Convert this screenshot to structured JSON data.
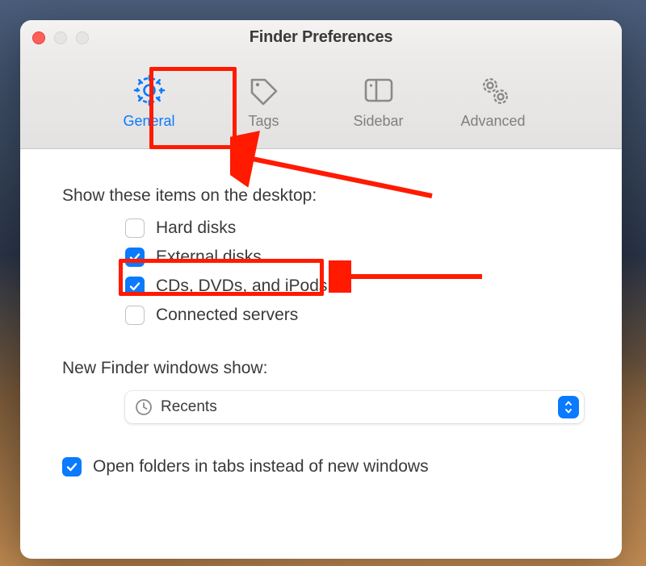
{
  "window": {
    "title": "Finder Preferences"
  },
  "toolbar": {
    "tabs": [
      {
        "id": "general",
        "label": "General",
        "active": true
      },
      {
        "id": "tags",
        "label": "Tags",
        "active": false
      },
      {
        "id": "sidebar",
        "label": "Sidebar",
        "active": false
      },
      {
        "id": "advanced",
        "label": "Advanced",
        "active": false
      }
    ]
  },
  "general": {
    "show_desktop_label": "Show these items on the desktop:",
    "items": [
      {
        "label": "Hard disks",
        "checked": false
      },
      {
        "label": "External disks",
        "checked": true
      },
      {
        "label": "CDs, DVDs, and iPods",
        "checked": true
      },
      {
        "label": "Connected servers",
        "checked": false
      }
    ],
    "new_windows_label": "New Finder windows show:",
    "new_windows_value": "Recents",
    "tabs_checkbox": {
      "label": "Open folders in tabs instead of new windows",
      "checked": true
    }
  },
  "annotations": {
    "highlight_general_tab": true,
    "highlight_external_disks": true
  }
}
